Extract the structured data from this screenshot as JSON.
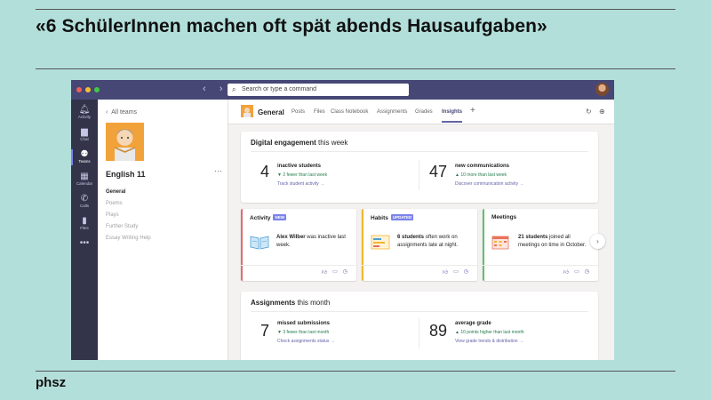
{
  "slide": {
    "title": "«6 SchülerInnen machen oft spät abends Hausaufgaben»",
    "footer": "phsz"
  },
  "titlebar": {
    "search_placeholder": "Search or type a command"
  },
  "rail": {
    "items": [
      {
        "label": "Activity",
        "icon": "bell-icon"
      },
      {
        "label": "Chat",
        "icon": "chat-icon"
      },
      {
        "label": "Teams",
        "icon": "teams-icon"
      },
      {
        "label": "Calendar",
        "icon": "calendar-icon"
      },
      {
        "label": "Calls",
        "icon": "phone-icon"
      },
      {
        "label": "Files",
        "icon": "file-icon"
      }
    ]
  },
  "team": {
    "back_label": "All teams",
    "name": "English 11",
    "more": "···",
    "channels": [
      "General",
      "Poems",
      "Plays",
      "Further Study",
      "Essay Writing Help"
    ]
  },
  "channel": {
    "title": "General",
    "tabs": [
      "Posts",
      "Files",
      "Class Notebook",
      "Assignments",
      "Grades",
      "Insights"
    ],
    "active_tab": "Insights"
  },
  "engagement": {
    "title_bold": "Digital engagement",
    "title_rest": " this week",
    "left": {
      "value": "4",
      "label": "inactive students",
      "change": "▼ 2 fewer than last week",
      "link": "Track student activity →"
    },
    "right": {
      "value": "47",
      "label": "new communications",
      "change": "▲ 10 more than last week",
      "link": "Discover communication activity →"
    }
  },
  "insights": [
    {
      "title": "Activity",
      "badge": "NEW",
      "badge_color": "#7b83eb",
      "accent": "#e86a6a",
      "bold": "Alex Wilber",
      "text": " was inactive last week."
    },
    {
      "title": "Habits",
      "badge": "UPDATED",
      "badge_color": "#7b83eb",
      "accent": "#f2b632",
      "bold": "6 students",
      "text": " often work on assignments late at night."
    },
    {
      "title": "Meetings",
      "badge": "",
      "badge_color": "",
      "accent": "#5fc16f",
      "bold": "21 students",
      "text": " joined all meetings on time in October."
    }
  ],
  "assignments": {
    "title_bold": "Assignments",
    "title_rest": " this month",
    "left": {
      "value": "7",
      "label": "missed submissions",
      "change": "▼ 3 fewer than last month",
      "link": "Check assignments status →"
    },
    "right": {
      "value": "89",
      "label": "average grade",
      "change": "▲ 10 points higher than last month",
      "link": "View grade trends & distribution →"
    }
  },
  "colors": {
    "titlebar": "#464775",
    "rail": "#33344a",
    "accent": "#6264a7",
    "slide_bg": "#b3dfdb"
  }
}
